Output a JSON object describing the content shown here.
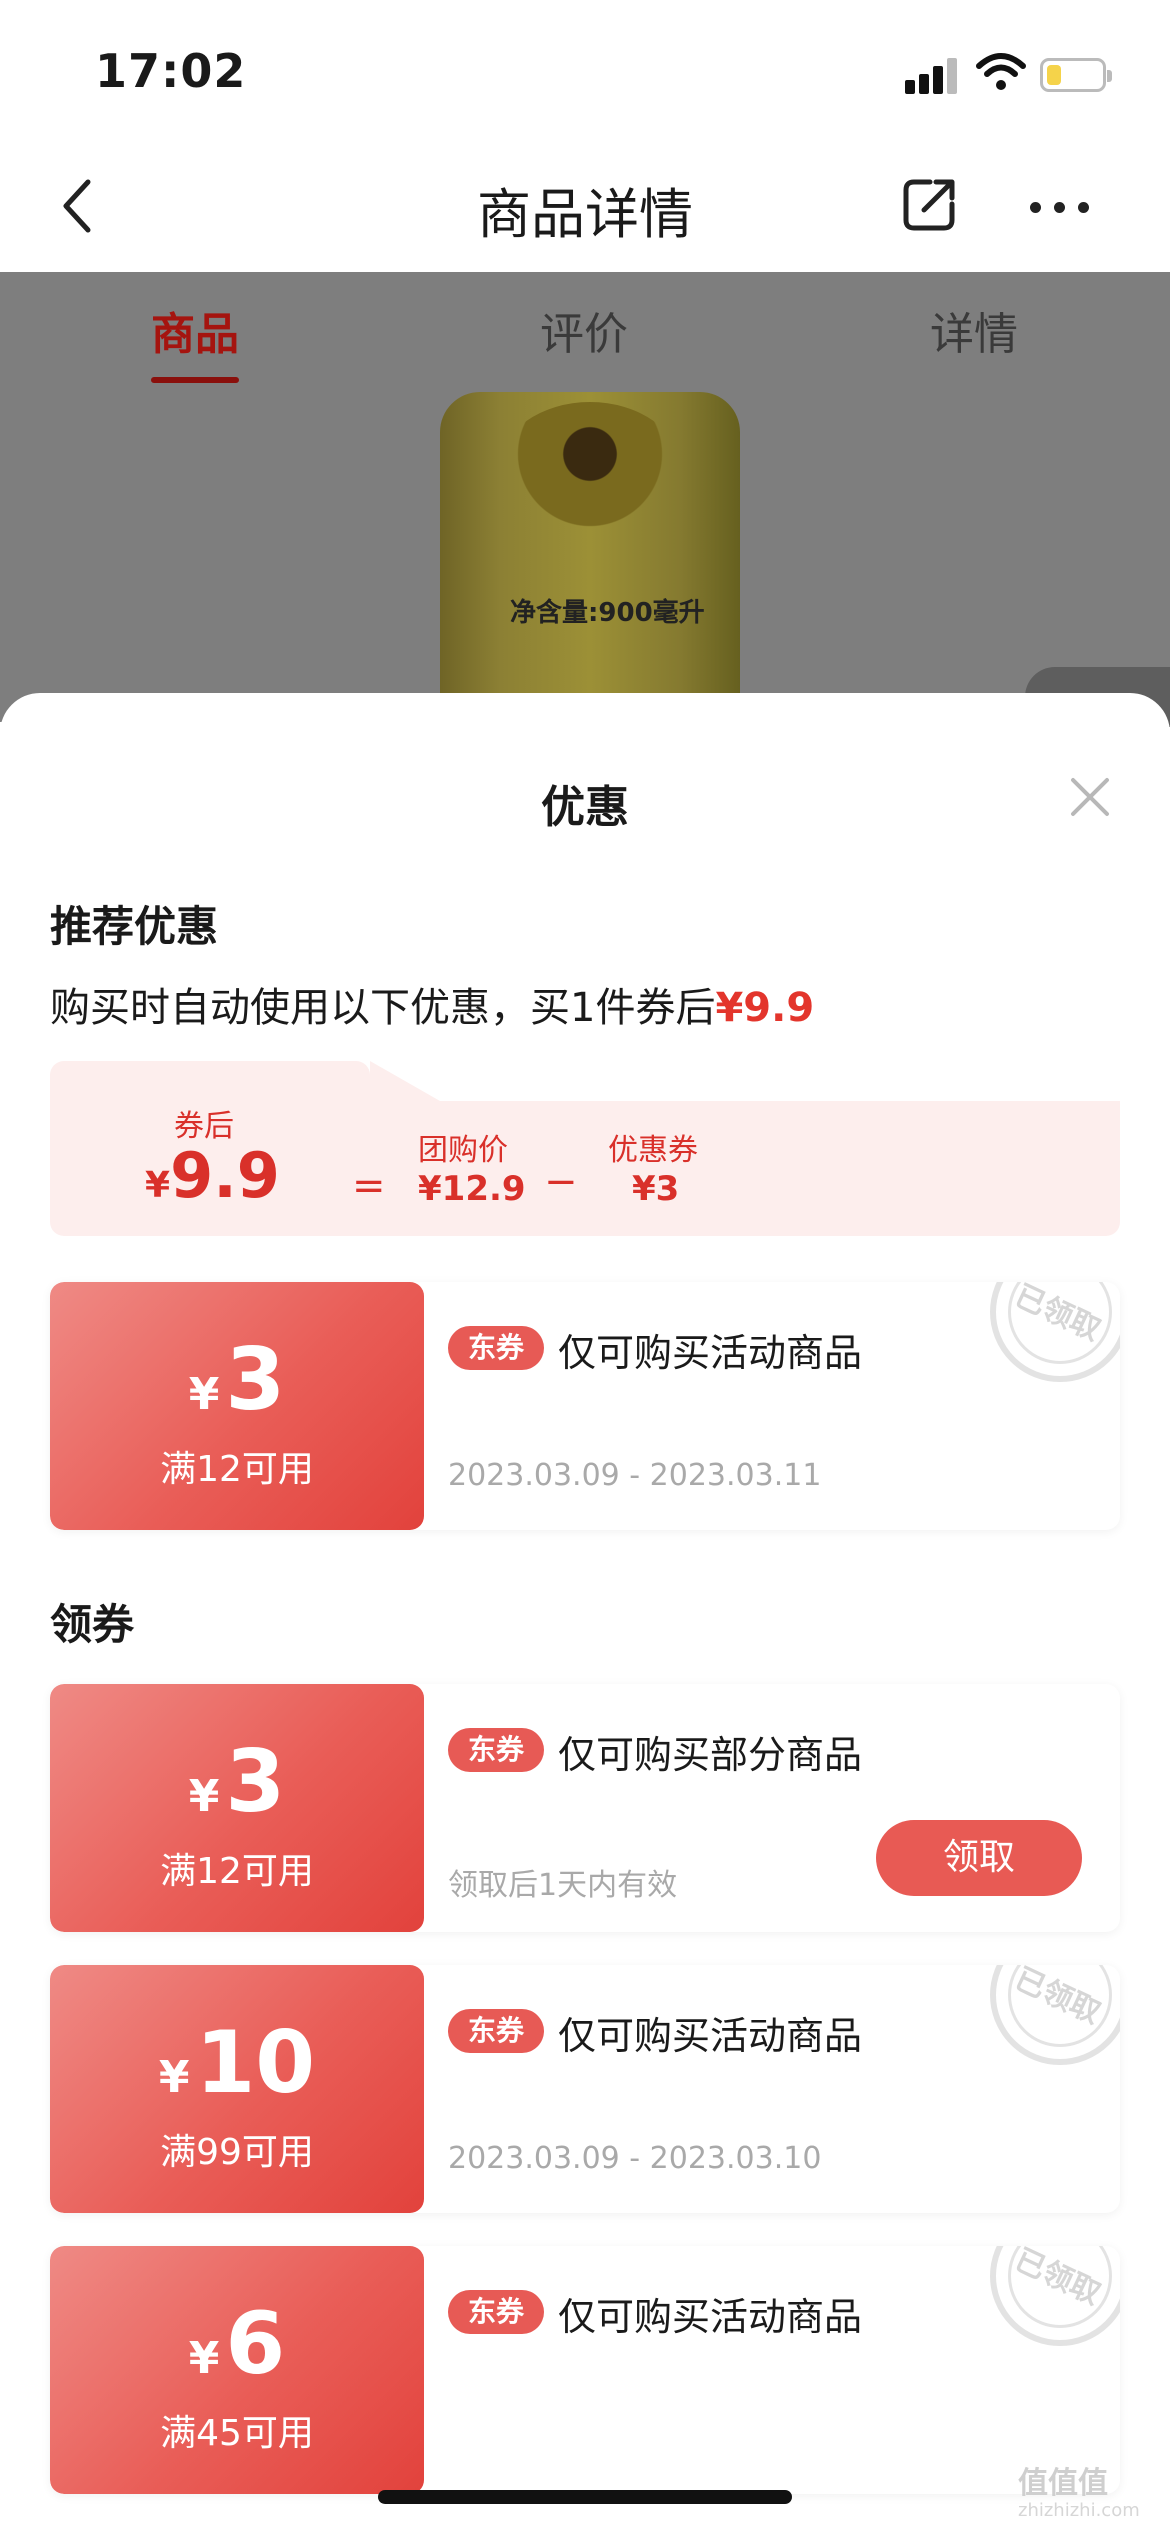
{
  "status_bar": {
    "time": "17:02"
  },
  "nav": {
    "title": "商品详情"
  },
  "tabs": [
    {
      "label": "商品",
      "active": true
    },
    {
      "label": "评价",
      "active": false
    },
    {
      "label": "详情",
      "active": false
    }
  ],
  "product_image": {
    "label": "净含量:900毫升"
  },
  "sheet": {
    "title": "优惠",
    "recommend": {
      "heading": "推荐优惠",
      "subtitle_prefix": "购买时自动使用以下优惠，买1件券后",
      "subtitle_price": "¥9.9"
    },
    "calc": {
      "after_label": "券后",
      "after_currency": "¥",
      "after_value": "9.9",
      "equals": "=",
      "group_label": "团购价",
      "group_value": "¥12.9",
      "minus": "−",
      "coupon_label": "优惠券",
      "coupon_value": "¥3"
    },
    "applied_coupon": {
      "currency": "¥",
      "amount": "3",
      "condition": "满12可用",
      "badge": "东券",
      "desc": "仅可购买活动商品",
      "date": "2023.03.09 - 2023.03.11",
      "stamp": "已领取"
    },
    "claim_heading": "领券",
    "coupons": [
      {
        "currency": "¥",
        "amount": "3",
        "condition": "满12可用",
        "badge": "东券",
        "desc": "仅可购买部分商品",
        "date": "领取后1天内有效",
        "button": "领取"
      },
      {
        "currency": "¥",
        "amount": "10",
        "condition": "满99可用",
        "badge": "东券",
        "desc": "仅可购买活动商品",
        "date": "2023.03.09 - 2023.03.10",
        "stamp": "已领取"
      },
      {
        "currency": "¥",
        "amount": "6",
        "condition": "满45可用",
        "badge": "东券",
        "desc": "仅可购买活动商品",
        "stamp": "已领取"
      }
    ]
  },
  "watermark": {
    "text": "值值值",
    "site": "zhizhizhi.com"
  },
  "colors": {
    "accent": "#e3352c",
    "tab_active": "#a5140f",
    "coupon_red": "#e95d57"
  }
}
